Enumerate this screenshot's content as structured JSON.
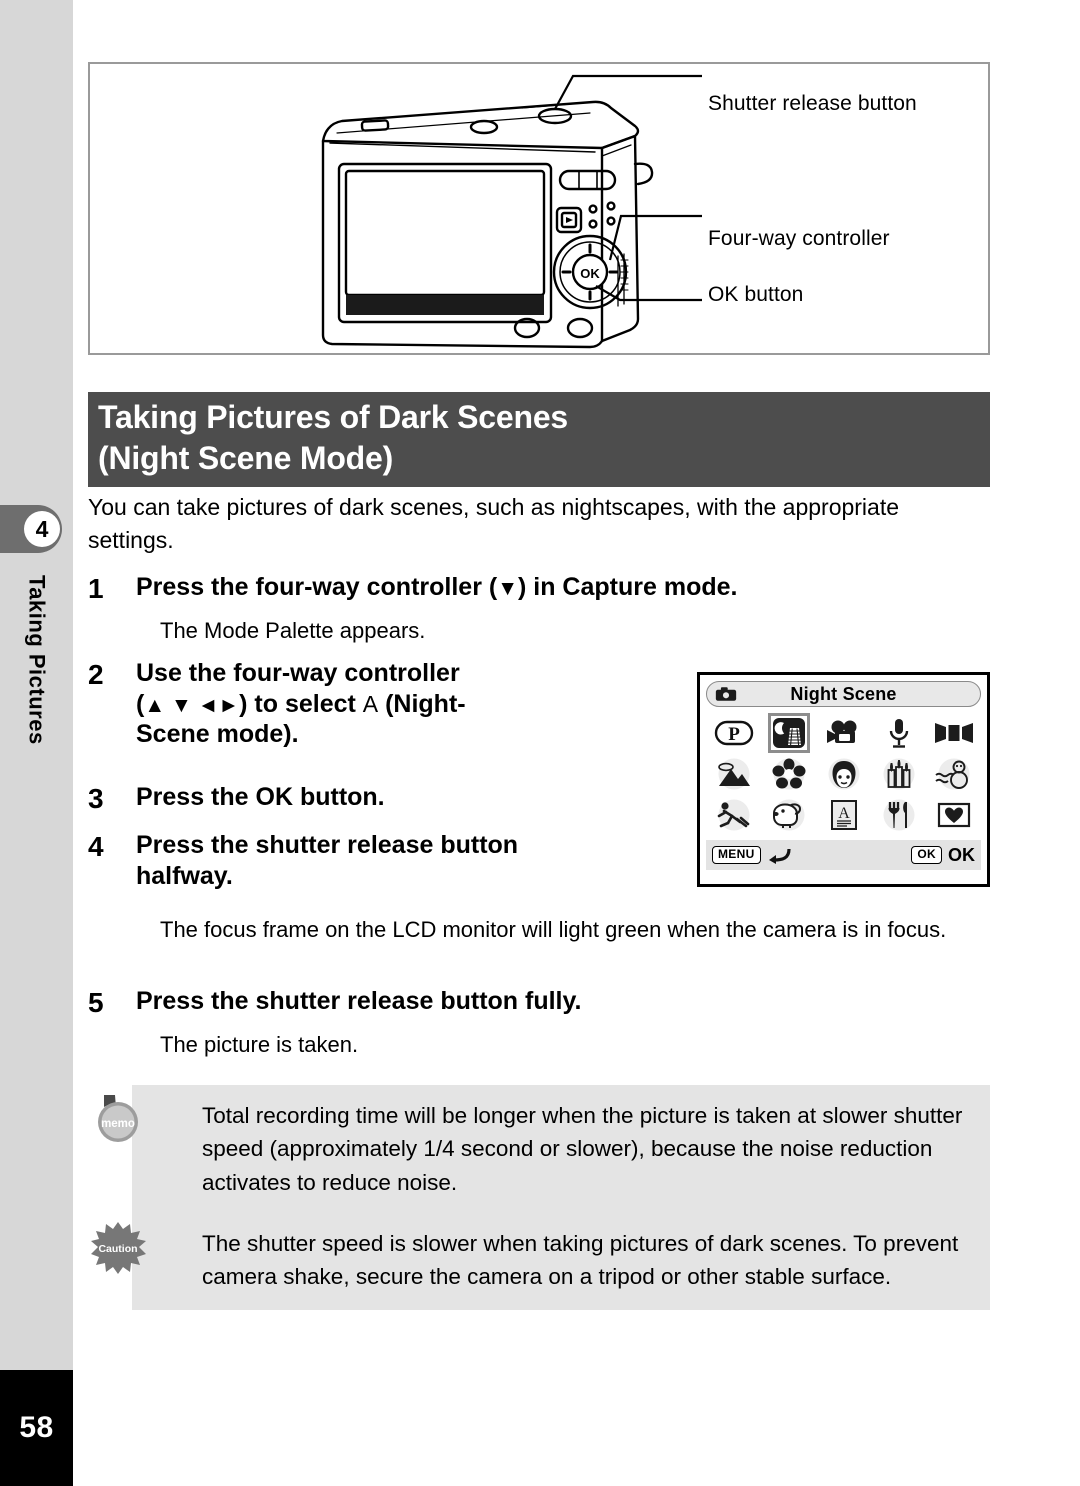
{
  "sidebar": {
    "chapter_number": "4",
    "chapter_title": "Taking Pictures",
    "page_number": "58"
  },
  "figure": {
    "callouts": [
      {
        "id": "shutter-release-button",
        "label": "Shutter release button"
      },
      {
        "id": "four-way-controller",
        "label": "Four-way controller"
      },
      {
        "id": "ok-button",
        "label": "OK button"
      }
    ]
  },
  "section": {
    "title_line1": "Taking Pictures of Dark Scenes",
    "title_line2": "(Night Scene Mode)",
    "title_bg": "#4d4d4d",
    "intro": "You can take pictures of dark scenes, such as nightscapes, with the appropriate settings."
  },
  "steps": [
    {
      "number": "1",
      "text_before": "Press the four-way controller (",
      "arrow": "▼",
      "text_after": ") in Capture mode.",
      "description": "The Mode Palette appears."
    },
    {
      "number": "2",
      "line1": "Use the four-way controller",
      "line2_before": "(",
      "line2_arrows": "▲ ▼ ◄►",
      "line2_mid": ") to select ",
      "line2_mode_letter": "A",
      "line2_after": "  (Night-",
      "line3": "Scene mode)."
    },
    {
      "number": "3",
      "text": "Press the OK button."
    },
    {
      "number": "4",
      "line1": "Press the shutter release button",
      "line2": "halfway.",
      "description": "The focus frame on the LCD monitor will light green when the camera is in focus."
    },
    {
      "number": "5",
      "text": "Press the shutter release button fully.",
      "description": "The picture is taken."
    }
  ],
  "lcd": {
    "header_label": "Night Scene",
    "header_icon": "camera-icon",
    "rows": [
      [
        {
          "icon": "program-mode-icon",
          "name": "P",
          "selected": false
        },
        {
          "icon": "night-scene-icon",
          "name": "Night Scene",
          "selected": true
        },
        {
          "icon": "movie-camera-icon",
          "name": "Movie",
          "selected": false
        },
        {
          "icon": "microphone-icon",
          "name": "Voice Recording",
          "selected": false
        },
        {
          "icon": "panorama-icon",
          "name": "Panorama Assist",
          "selected": false
        }
      ],
      [
        {
          "icon": "landscape-icon",
          "name": "Landscape",
          "selected": false
        },
        {
          "icon": "flower-icon",
          "name": "Flower",
          "selected": false
        },
        {
          "icon": "portrait-icon",
          "name": "Portrait",
          "selected": false
        },
        {
          "icon": "candle-icon",
          "name": "Soft",
          "selected": false
        },
        {
          "icon": "snowman-icon",
          "name": "Surf & Snow",
          "selected": false
        }
      ],
      [
        {
          "icon": "sport-runner-icon",
          "name": "Sport",
          "selected": false
        },
        {
          "icon": "pet-dog-icon",
          "name": "Pet",
          "selected": false
        },
        {
          "icon": "text-page-icon",
          "name": "Text",
          "selected": false
        },
        {
          "icon": "food-icon",
          "name": "Food",
          "selected": false
        },
        {
          "icon": "frame-heart-icon",
          "name": "Frame Composite",
          "selected": false
        }
      ]
    ],
    "footer": {
      "menu_key": "MENU",
      "menu_action_icon": "back-arrow-icon",
      "ok_key": "OK",
      "ok_label": "OK"
    }
  },
  "notes": [
    {
      "type": "memo",
      "icon": "memo-icon",
      "icon_label": "memo",
      "text": "Total recording time will be longer when the picture is taken at slower shutter speed (approximately 1/4 second or slower), because the noise reduction activates to reduce noise."
    },
    {
      "type": "caution",
      "icon": "caution-icon",
      "icon_label": "Caution",
      "text": "The shutter speed is slower when taking pictures of dark scenes. To prevent camera shake, secure the camera on a tripod or other stable surface."
    }
  ]
}
